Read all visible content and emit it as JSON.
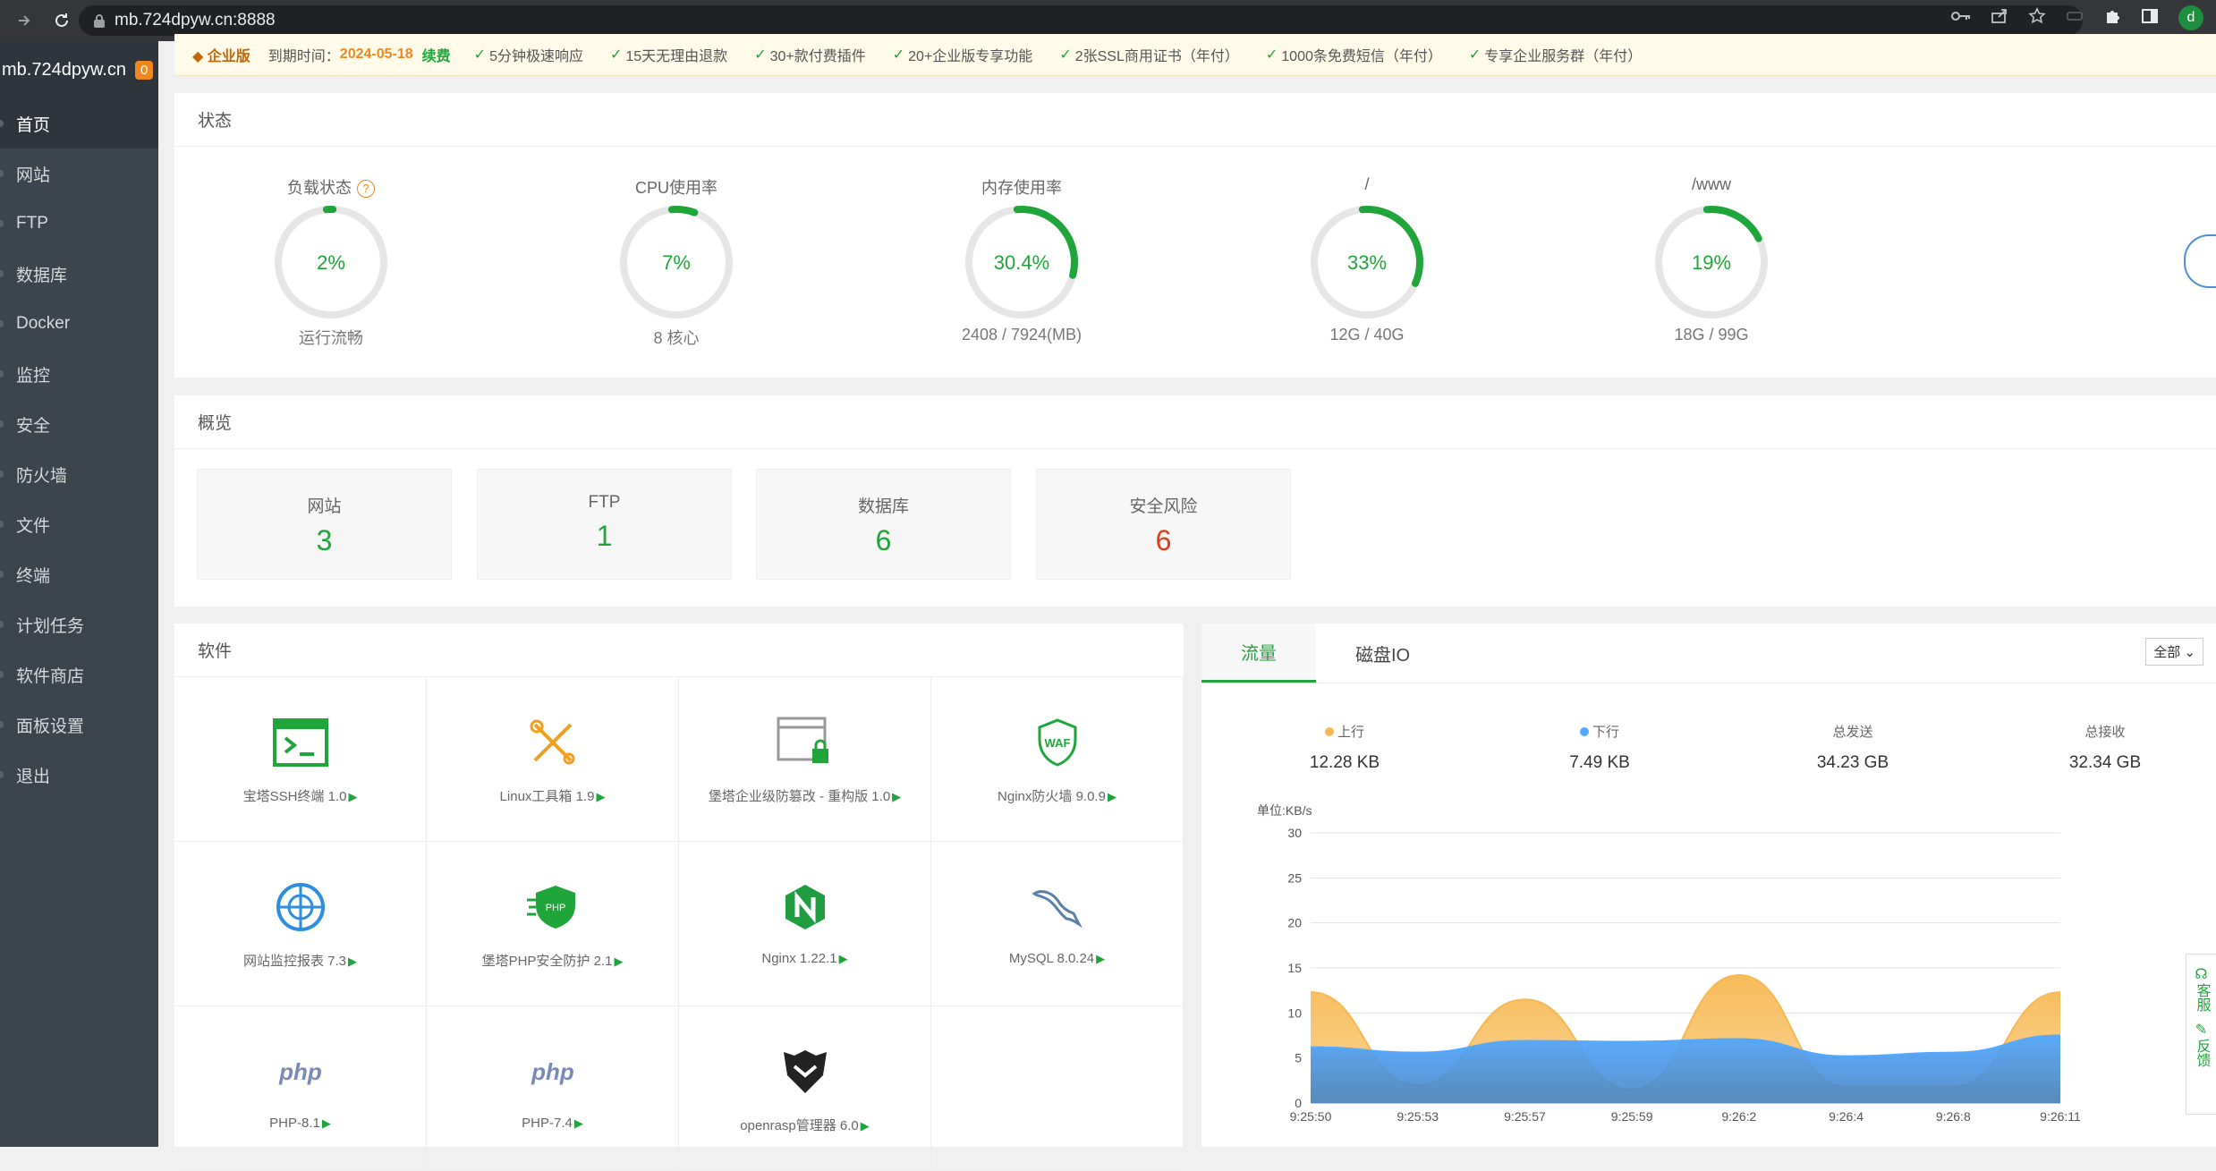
{
  "browser": {
    "url": "mb.724dpyw.cn:8888",
    "avatar_letter": "d"
  },
  "sidebar": {
    "host": "mb.724dpyw.cn",
    "badge": "0",
    "items": [
      {
        "label": "首页",
        "active": true
      },
      {
        "label": "网站"
      },
      {
        "label": "FTP"
      },
      {
        "label": "数据库"
      },
      {
        "label": "Docker"
      },
      {
        "label": "监控"
      },
      {
        "label": "安全"
      },
      {
        "label": "防火墙"
      },
      {
        "label": "文件"
      },
      {
        "label": "终端"
      },
      {
        "label": "计划任务"
      },
      {
        "label": "软件商店"
      },
      {
        "label": "面板设置"
      },
      {
        "label": "退出"
      }
    ]
  },
  "enterprise": {
    "tag": "企业版",
    "expire_label": "到期时间：",
    "expire_date": "2024-05-18",
    "renew": "续费",
    "features": [
      "5分钟极速响应",
      "15天无理由退款",
      "30+款付费插件",
      "20+企业版专享功能",
      "2张SSL商用证书（年付）",
      "1000条免费短信（年付）",
      "专享企业服务群（年付）"
    ]
  },
  "status": {
    "title": "状态",
    "gauges": [
      {
        "label": "负载状态",
        "value_text": "2%",
        "value": 2,
        "sub": "运行流畅",
        "help": "?"
      },
      {
        "label": "CPU使用率",
        "value_text": "7%",
        "value": 7,
        "sub": "8 核心"
      },
      {
        "label": "内存使用率",
        "value_text": "30.4%",
        "value": 30.4,
        "sub": "2408 / 7924(MB)"
      },
      {
        "label": "/",
        "value_text": "33%",
        "value": 33,
        "sub": "12G / 40G"
      },
      {
        "label": "/www",
        "value_text": "19%",
        "value": 19,
        "sub": "18G / 99G"
      }
    ]
  },
  "overview": {
    "title": "概览",
    "cards": [
      {
        "label": "网站",
        "value": "3"
      },
      {
        "label": "FTP",
        "value": "1"
      },
      {
        "label": "数据库",
        "value": "6"
      },
      {
        "label": "安全风险",
        "value": "6"
      }
    ]
  },
  "software": {
    "title": "软件",
    "items": [
      {
        "name": "宝塔SSH终端 1.0",
        "icon": "terminal-icon"
      },
      {
        "name": "Linux工具箱 1.9",
        "icon": "tools-icon"
      },
      {
        "name": "堡塔企业级防篡改 - 重构版 1.0",
        "icon": "tamper-proof-icon"
      },
      {
        "name": "Nginx防火墙 9.0.9",
        "icon": "waf-icon",
        "icon_text": "WAF"
      },
      {
        "name": "网站监控报表 7.3",
        "icon": "monitor-report-icon"
      },
      {
        "name": "堡塔PHP安全防护 2.1",
        "icon": "php-guard-icon"
      },
      {
        "name": "Nginx 1.22.1",
        "icon": "nginx-icon",
        "icon_text": "N"
      },
      {
        "name": "MySQL 8.0.24",
        "icon": "mysql-icon"
      },
      {
        "name": "PHP-8.1",
        "icon": "php-icon",
        "icon_text": "php"
      },
      {
        "name": "PHP-7.4",
        "icon": "php-icon",
        "icon_text": "php"
      },
      {
        "name": "openrasp管理器 6.0",
        "icon": "openrasp-icon"
      }
    ]
  },
  "traffic": {
    "tabs": [
      "流量",
      "磁盘IO"
    ],
    "select": "全部",
    "stats": [
      {
        "label": "上行",
        "value": "12.28 KB",
        "color": "#f7b851"
      },
      {
        "label": "下行",
        "value": "7.49 KB",
        "color": "#52a9ff"
      },
      {
        "label": "总发送",
        "value": "34.23 GB"
      },
      {
        "label": "总接收",
        "value": "32.34 GB"
      }
    ],
    "chart_data": {
      "type": "area",
      "ylabel": "单位:KB/s",
      "ylim": [
        0,
        30
      ],
      "yticks": [
        0,
        5,
        10,
        15,
        20,
        25,
        30
      ],
      "x": [
        "9:25:50",
        "9:25:53",
        "9:25:57",
        "9:25:59",
        "9:26:2",
        "9:26:4",
        "9:26:8",
        "9:26:11"
      ],
      "series": [
        {
          "name": "上行",
          "color": "#f7b851",
          "values": [
            12.3,
            2,
            11.5,
            1.5,
            14.2,
            1.8,
            1.8,
            12.3
          ]
        },
        {
          "name": "下行",
          "color": "#52a9ff",
          "values": [
            6.2,
            5.6,
            6.9,
            6.8,
            7.1,
            5.2,
            5.6,
            7.5
          ]
        }
      ]
    }
  },
  "float_service": {
    "service": "客服",
    "feedback": "反馈"
  }
}
